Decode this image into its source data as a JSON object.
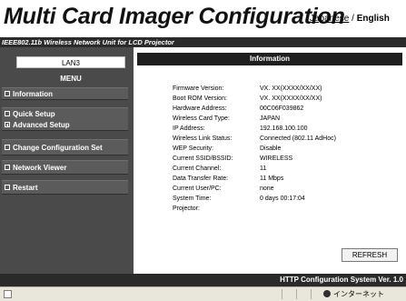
{
  "header": {
    "title": "Multi Card Imager Configuration",
    "lang_japanese": "Japanese",
    "lang_sep": " / ",
    "lang_english": "English"
  },
  "subtitle": "IEEE802.11b Wireless Network Unit for LCD Projector",
  "sidebar": {
    "unit_name": "LAN3",
    "menu_heading": "MENU",
    "items": [
      {
        "label": "Information",
        "icon": "box"
      },
      {
        "label": "Quick Setup",
        "icon": "box"
      },
      {
        "label": "Advanced Setup",
        "icon": "plus-box"
      },
      {
        "label": "Change Configuration Set",
        "icon": "box"
      },
      {
        "label": "Network Viewer",
        "icon": "box"
      },
      {
        "label": "Restart",
        "icon": "box"
      }
    ]
  },
  "main": {
    "section_title": "Information",
    "rows": [
      {
        "label": "Firmware Version:",
        "value": "VX. XX(XXXX/XX/XX)"
      },
      {
        "label": "Boot ROM Version:",
        "value": "VX. XX(XXXX/XX/XX)"
      },
      {
        "label": "Hardware Address:",
        "value": "00C06F039862"
      },
      {
        "label": "Wireless Card Type:",
        "value": "JAPAN"
      },
      {
        "label": "IP Address:",
        "value": "192.168.100.100"
      },
      {
        "label": "Wireless Link Status:",
        "value": "Connected (802.11 AdHoc)"
      },
      {
        "label": "WEP Security:",
        "value": "Disable"
      },
      {
        "label": "Current SSID/BSSID:",
        "value": "WIRELESS"
      },
      {
        "label": "Current Channel:",
        "value": "11"
      },
      {
        "label": "Data Transfer Rate:",
        "value": "11 Mbps"
      },
      {
        "label": "Current User/PC:",
        "value": "none"
      },
      {
        "label": "System Time:",
        "value": "0 days 00:17:04"
      },
      {
        "label": "Projector:",
        "value": ""
      }
    ],
    "refresh_label": "REFRESH"
  },
  "footer": {
    "text": "HTTP Configuration System Ver. 1.0"
  },
  "statusbar": {
    "zone": "インターネット"
  },
  "colors": {
    "sidebar_bg": "#4a4a4a",
    "nav_bg": "#5b5b5b",
    "bar_dark": "#1f1f1f"
  }
}
